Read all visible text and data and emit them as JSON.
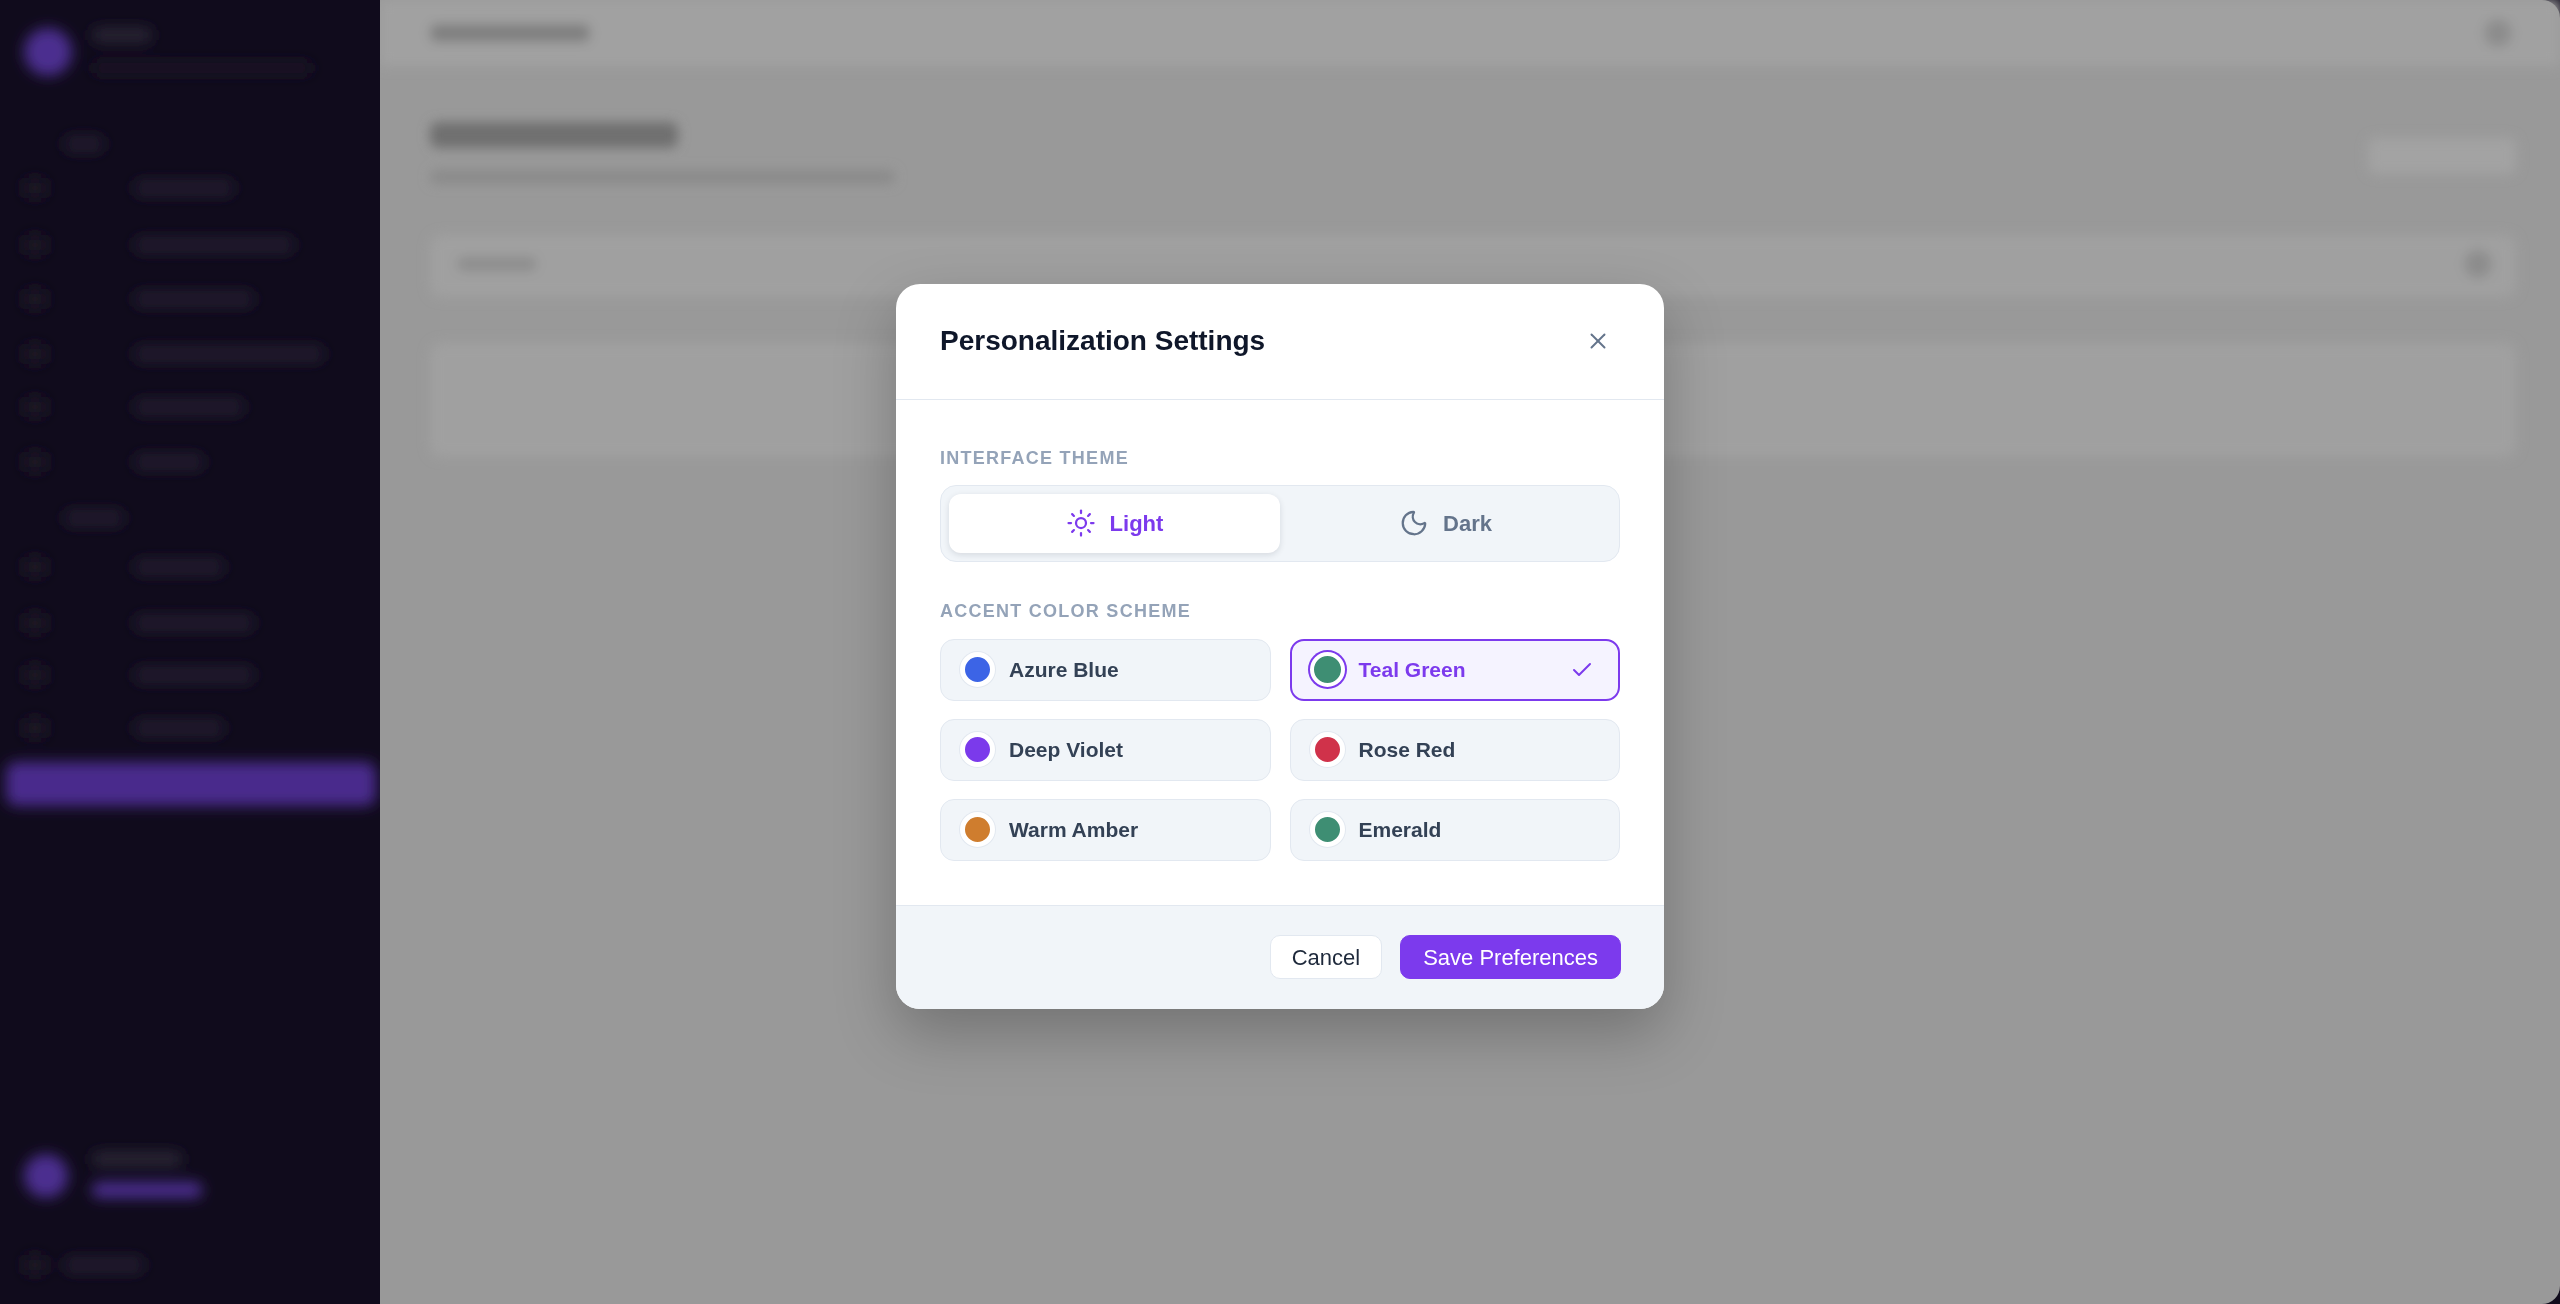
{
  "dialog": {
    "title": "Personalization Settings"
  },
  "theme": {
    "label": "INTERFACE THEME",
    "options": [
      {
        "label": "Light",
        "selected": true
      },
      {
        "label": "Dark",
        "selected": false
      }
    ]
  },
  "accent": {
    "label": "ACCENT COLOR SCHEME",
    "options": [
      {
        "label": "Azure Blue",
        "color": "#3c64e6",
        "selected": false
      },
      {
        "label": "Teal Green",
        "color": "#3e8e73",
        "selected": true
      },
      {
        "label": "Deep Violet",
        "color": "#7b3aeb",
        "selected": false
      },
      {
        "label": "Rose Red",
        "color": "#d0324a",
        "selected": false
      },
      {
        "label": "Warm Amber",
        "color": "#cf7d2e",
        "selected": false
      },
      {
        "label": "Emerald",
        "color": "#3e8e73",
        "selected": false
      }
    ]
  },
  "footer": {
    "buttons": [
      {
        "label": "Cancel",
        "kind": "secondary"
      },
      {
        "label": "Save Preferences",
        "kind": "primary"
      }
    ]
  }
}
